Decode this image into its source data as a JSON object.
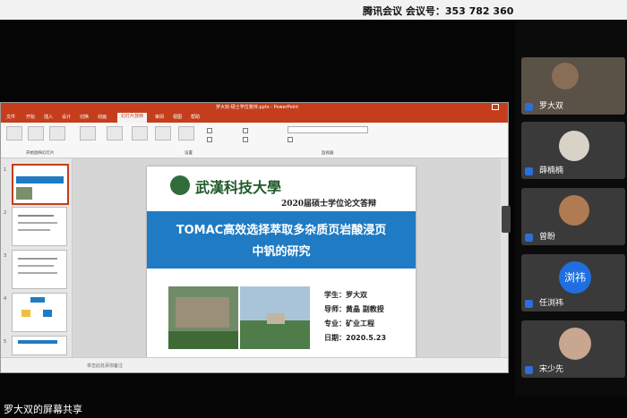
{
  "meeting": {
    "title": "腾讯会议 会议号：353 782 360",
    "share_label": "罗大双的屏幕共享"
  },
  "ppt": {
    "window_title": "罗大双-硕士学位答辩.pptx - PowerPoint",
    "tabs": [
      "文件",
      "开始",
      "插入",
      "设计",
      "切换",
      "动画",
      "幻灯片放映",
      "审阅",
      "视图",
      "帮助"
    ],
    "active_tab": "幻灯片放映",
    "ribbon_groups": [
      "开始放映幻灯片",
      "设置",
      "监视器"
    ],
    "slide_numbers": [
      "1",
      "2",
      "3",
      "4",
      "5"
    ],
    "status_text": "单击此处添加备注"
  },
  "slide": {
    "logo_text": "武漢科技大學",
    "subtitle": "2020届硕士学位论文答辩",
    "main_title_line1": "TOMAC高效选择萃取多杂质页岩酸浸页",
    "main_title_line2": "中钒的研究",
    "student": "学生：罗大双",
    "advisor": "导师：黄晶 副教授",
    "major": "专业：矿业工程",
    "date": "日期：2020.5.23"
  },
  "participants": [
    {
      "name": "罗大双",
      "avatar": "video"
    },
    {
      "name": "薛楠楠",
      "avatar": "photo"
    },
    {
      "name": "曾盼",
      "avatar": "photo"
    },
    {
      "name": "任浏祎",
      "avatar": "浏祎"
    },
    {
      "name": "宋少先",
      "avatar": "photo"
    }
  ],
  "colors": {
    "accent": "#c43e1c",
    "slide_blue": "#1e7bc4",
    "tile_bg": "#3a3a3a"
  }
}
